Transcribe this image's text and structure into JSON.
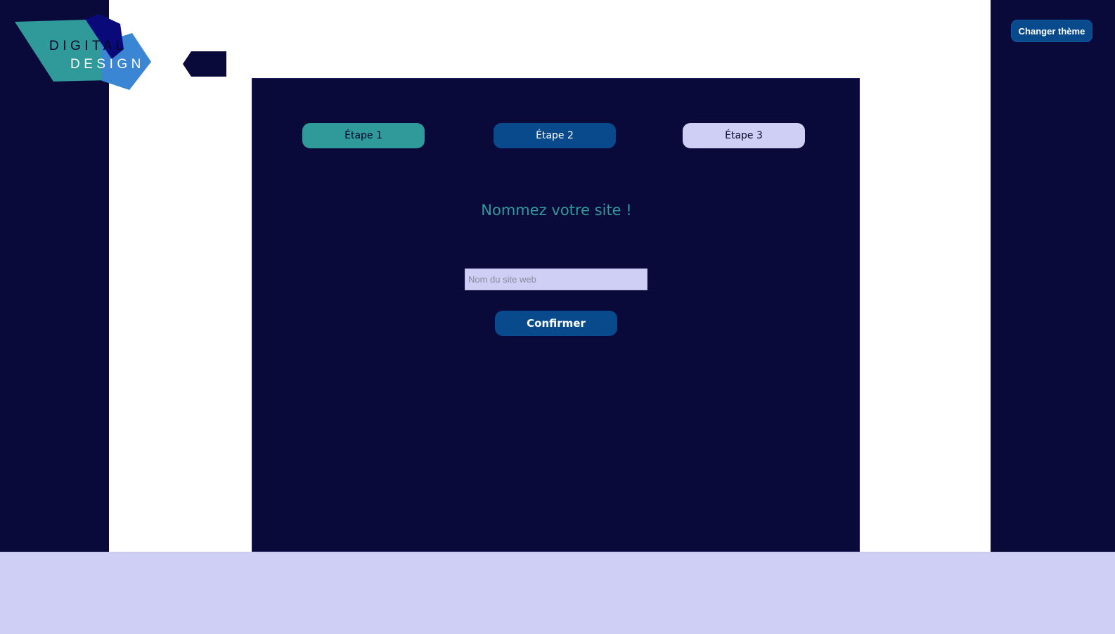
{
  "brand": {
    "line1": "DIGITAL",
    "line2": "DESIGN"
  },
  "header": {
    "theme_button_label": "Changer thème"
  },
  "steps": [
    {
      "label": "Étape 1",
      "state": "active"
    },
    {
      "label": "Étape 2",
      "state": "next"
    },
    {
      "label": "Étape 3",
      "state": "upcoming"
    }
  ],
  "main": {
    "heading": "Nommez votre site !",
    "input_placeholder": "Nom du site web",
    "input_value": "",
    "confirm_label": "Confirmer"
  },
  "colors": {
    "navy": "#0a0a3a",
    "teal": "#30999a",
    "blue": "#084a8c",
    "lavender": "#cfcef5",
    "white": "#ffffff"
  }
}
